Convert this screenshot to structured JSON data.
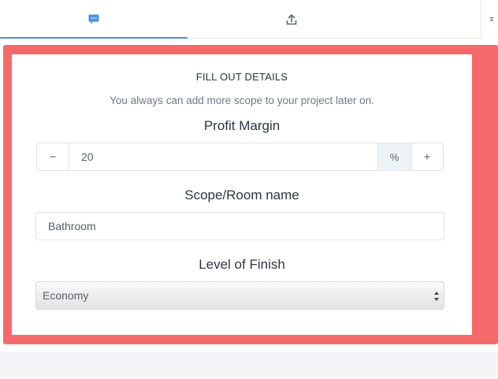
{
  "tabs": [
    {
      "name": "chat",
      "icon": "chat-bubble-icon",
      "active": true,
      "accent": "#4a90e2"
    },
    {
      "name": "upload",
      "icon": "upload-icon",
      "active": false
    }
  ],
  "form": {
    "heading": "FILL OUT DETAILS",
    "subtitle": "You always can add more scope to your project later on.",
    "profit_margin": {
      "label": "Profit Margin",
      "decrement_label": "−",
      "value": "20",
      "unit": "%",
      "increment_label": "+"
    },
    "scope": {
      "label": "Scope/Room name",
      "value": "Bathroom"
    },
    "finish": {
      "label": "Level of Finish",
      "selected": "Economy"
    }
  },
  "colors": {
    "highlight_frame": "#f46a6a",
    "active_tab": "#4a90e2"
  }
}
